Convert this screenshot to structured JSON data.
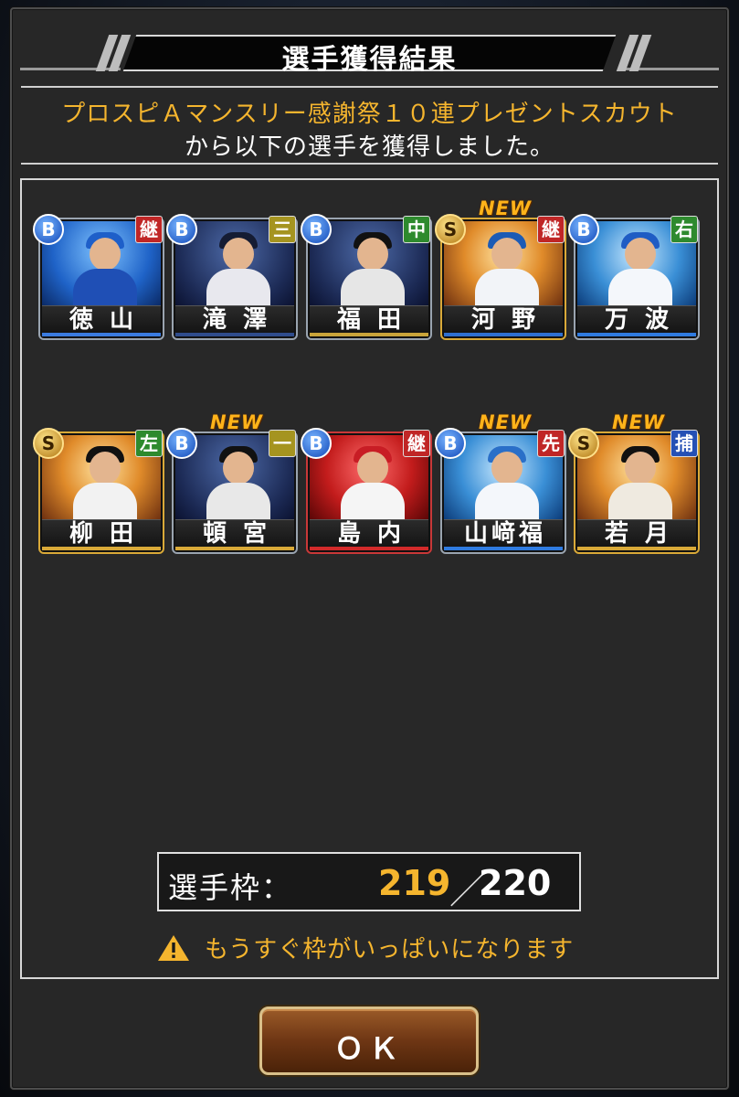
{
  "header": {
    "title": "選手獲得結果"
  },
  "message": {
    "line1": "プロスピＡマンスリー感謝祭１０連プレゼントスカウト",
    "line2": "から以下の選手を獲得しました。"
  },
  "players": [
    {
      "name": "徳山",
      "rank": "B",
      "position": "継",
      "is_new": false
    },
    {
      "name": "滝澤",
      "rank": "B",
      "position": "三",
      "is_new": false
    },
    {
      "name": "福田",
      "rank": "B",
      "position": "中",
      "is_new": false
    },
    {
      "name": "河野",
      "rank": "S",
      "position": "継",
      "is_new": true
    },
    {
      "name": "万波",
      "rank": "B",
      "position": "右",
      "is_new": false
    },
    {
      "name": "柳田",
      "rank": "S",
      "position": "左",
      "is_new": false
    },
    {
      "name": "頓宮",
      "rank": "B",
      "position": "一",
      "is_new": true
    },
    {
      "name": "島内",
      "rank": "B",
      "position": "継",
      "is_new": false
    },
    {
      "name": "山﨑福",
      "rank": "B",
      "position": "先",
      "is_new": true
    },
    {
      "name": "若月",
      "rank": "S",
      "position": "捕",
      "is_new": true
    }
  ],
  "new_label": "NEW",
  "roster": {
    "label": "選手枠：",
    "current": "219",
    "separator": "／",
    "max": "220"
  },
  "warning": {
    "text": "もうすぐ枠がいっぱいになります",
    "icon": "warning-icon"
  },
  "ok_button": {
    "label": "ＯＫ"
  },
  "colors": {
    "accent_gold": "#f5b52e",
    "panel": "#272727",
    "position_red": "#c02626",
    "position_green": "#2e8a2e",
    "position_olive": "#a59420",
    "position_blue": "#2550b5"
  }
}
